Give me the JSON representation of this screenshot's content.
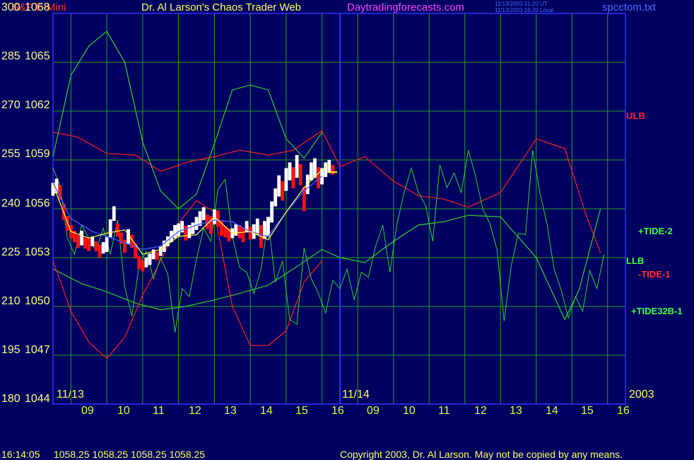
{
  "header": {
    "instrument": "S&P E-Mini",
    "site_title": "Dr. Al Larson's Chaos Trader Web",
    "website": "Daytradingforecasts.com",
    "timestamp_ut": "11/13/2003 21:20 UT",
    "timestamp_local": "11/13/2003 16:20 Local",
    "filename": "spcctom.txt"
  },
  "footer": {
    "time": "16:14:05",
    "quotes": "1058.25 1058.25 1058.25 1058.25",
    "copyright": "Copyright 2003, Dr. Al Larson. May not be copied by any means."
  },
  "colors": {
    "background": "#000060",
    "grid": "#1fa01f",
    "price_up": "#ffffff",
    "price_down": "#ff1010",
    "tide": "#2fd02f",
    "band": "#ff2020",
    "divider": "#3030ff"
  },
  "chart_data": {
    "type": "line",
    "y_left_ticks": [
      "300",
      "285",
      "270",
      "255",
      "240",
      "225",
      "210",
      "195",
      "180"
    ],
    "y_right_ticks": [
      "1068",
      "1065",
      "1062",
      "1059",
      "1056",
      "1053",
      "1050",
      "1047",
      "1044"
    ],
    "ylim_price": [
      1044,
      1068
    ],
    "ylim_index": [
      180,
      300
    ],
    "day_labels": [
      "11/13",
      "11/14"
    ],
    "year_label": "2003",
    "x_hours_day1": [
      "09",
      "10",
      "11",
      "12",
      "13",
      "14",
      "15",
      "16"
    ],
    "x_hours_day2": [
      "09",
      "10",
      "11",
      "12",
      "13",
      "14",
      "15",
      "16"
    ],
    "grid": true,
    "annotations": [
      {
        "text": "ULB",
        "color": "#ff2020"
      },
      {
        "text": "+TIDE-2",
        "color": "#40ff40"
      },
      {
        "text": "LLB",
        "color": "#40ff40"
      },
      {
        "text": "-TIDE-1",
        "color": "#ff3030"
      },
      {
        "text": "+TIDE32B-1",
        "color": "#40ff40"
      }
    ],
    "series": [
      {
        "name": "ULB",
        "color": "#ff2020",
        "x": [
          8.5,
          9.2,
          10,
          10.8,
          11.5,
          12.3,
          13,
          13.7,
          14.5,
          15.2,
          16,
          16.5,
          17.2,
          18,
          18.7,
          19.4,
          20.1,
          21,
          22,
          22.8,
          23.4,
          23.8
        ],
        "y": [
          1060.7,
          1060.4,
          1059.4,
          1059.3,
          1058.3,
          1058.9,
          1059.2,
          1059.6,
          1059.3,
          1059.6,
          1060.8,
          1058.6,
          1059.2,
          1057.7,
          1056.8,
          1056.6,
          1056.1,
          1057.0,
          1060.3,
          1059.7,
          1055.6,
          1053.3
        ]
      },
      {
        "name": "LLB",
        "color": "#2fd02f",
        "x": [
          8.5,
          9.3,
          10,
          10.8,
          11.5,
          12.2,
          13,
          13.7,
          14.5,
          15.2,
          16,
          16.5,
          17.2,
          18,
          18.7,
          19.4,
          20.1,
          21,
          22,
          22.8,
          23.2,
          23.8
        ],
        "y": [
          1052.3,
          1051.4,
          1050.9,
          1050.2,
          1049.8,
          1050.0,
          1050.4,
          1050.8,
          1051.3,
          1052.3,
          1053.5,
          1053.0,
          1052.7,
          1054.0,
          1055.0,
          1055.2,
          1055.6,
          1055.5,
          1053.0,
          1049.2,
          1051.0,
          1056.0
        ]
      },
      {
        "name": "-TIDE-1",
        "color": "#ff2020",
        "x": [
          8.5,
          9,
          9.5,
          10,
          10.5,
          11,
          11.5,
          12,
          12.5,
          13,
          13.5,
          14,
          14.5,
          15,
          15.5,
          16
        ],
        "y": [
          1052.8,
          1049.7,
          1047.8,
          1046.8,
          1048.1,
          1050.7,
          1052.8,
          1055.1,
          1056.5,
          1055.8,
          1050.0,
          1047.6,
          1047.6,
          1048.5,
          1051.5,
          1052.8
        ]
      },
      {
        "name": "+TIDE-2",
        "color": "#2fd02f",
        "x": [
          8.5,
          9,
          9.5,
          10,
          10.5,
          11,
          11.5,
          12,
          12.5,
          13,
          13.5,
          14,
          14.5,
          15,
          15.5,
          16
        ],
        "y": [
          1059.2,
          1064.2,
          1066.0,
          1066.9,
          1065.0,
          1060.1,
          1057.1,
          1056.0,
          1056.9,
          1060.0,
          1063.3,
          1063.6,
          1063.3,
          1060.3,
          1059.1,
          1060.7
        ]
      }
    ],
    "tide32": {
      "name": "+TIDE32B-1",
      "color": "#2fd02f",
      "x": [
        8.5,
        8.7,
        8.9,
        9.1,
        9.3,
        9.5,
        9.7,
        9.9,
        10.1,
        10.3,
        10.5,
        10.7,
        10.9,
        11.1,
        11.3,
        11.5,
        11.7,
        11.9,
        12.1,
        12.3,
        12.5,
        12.7,
        12.9,
        13.1,
        13.3,
        13.5,
        13.7,
        13.9,
        14.1,
        14.3,
        14.5,
        14.7,
        14.9,
        15.1,
        15.3,
        15.5,
        15.7,
        15.9,
        16.1,
        16.3,
        16.5,
        16.7,
        16.9,
        17.1,
        17.3,
        17.5,
        17.7,
        17.9,
        18.1,
        18.3,
        18.5,
        18.7,
        18.9,
        19.1,
        19.3,
        19.5,
        19.7,
        19.9,
        20.1,
        20.3,
        20.5,
        20.7,
        20.9,
        21.1,
        21.3,
        21.5,
        21.7,
        21.9,
        22.1,
        22.3,
        22.5,
        22.7,
        22.9,
        23.1,
        23.3,
        23.5,
        23.7,
        23.9
      ],
      "y": [
        1058.5,
        1057.4,
        1054.2,
        1053.2,
        1055.0,
        1054.2,
        1053.4,
        1054.8,
        1053.2,
        1055.3,
        1051.2,
        1049.4,
        1052.5,
        1053.4,
        1051.7,
        1053.0,
        1052.0,
        1048.4,
        1051.1,
        1050.6,
        1052.9,
        1054.8,
        1054.0,
        1057.2,
        1057.8,
        1054.3,
        1052.4,
        1052.1,
        1050.8,
        1052.3,
        1055.3,
        1051.5,
        1052.8,
        1049.2,
        1048.9,
        1053.6,
        1051.7,
        1050.8,
        1049.6,
        1051.6,
        1051.1,
        1052.3,
        1050.4,
        1052.1,
        1051.8,
        1053.7,
        1055.0,
        1052.1,
        1055.1,
        1057.0,
        1058.5,
        1057.0,
        1056.2,
        1054.0,
        1058.7,
        1057.3,
        1058.2,
        1057.0,
        1059.6,
        1058.0,
        1056.0,
        1055.1,
        1053.5,
        1049.1,
        1052.5,
        1054.5,
        1054.4,
        1059.6,
        1057.0,
        1055.1,
        1052.3,
        1051.0,
        1049.3,
        1050.6,
        1049.7,
        1052.2,
        1051.1,
        1053.2
      ]
    },
    "avg_line": {
      "name": "blue moving average",
      "color": "#4060ff",
      "x": [
        8.5,
        9,
        9.6,
        10,
        10.5,
        11,
        11.5,
        12,
        12.5,
        13,
        13.5,
        14,
        14.5,
        15,
        15.5,
        16
      ],
      "y": [
        1057.6,
        1055.4,
        1054.6,
        1054.3,
        1053.9,
        1053.5,
        1053.7,
        1054.6,
        1055.0,
        1055.3,
        1055.2,
        1054.6,
        1054.3,
        1055.8,
        1057.1,
        1058.0
      ]
    },
    "yellow_line": {
      "name": "yellow average",
      "color": "#ffff40",
      "x": [
        8.5,
        9,
        9.5,
        10,
        10.5,
        11,
        11.5,
        12,
        12.5,
        13,
        13.5,
        14,
        14.5,
        15,
        15.5,
        16,
        16.2
      ],
      "y": [
        1057.5,
        1054.6,
        1054.2,
        1054.5,
        1054.7,
        1053.2,
        1053.5,
        1054.3,
        1054.4,
        1055.5,
        1054.5,
        1054.6,
        1054.1,
        1055.8,
        1057.3,
        1058.4,
        1058.7
      ]
    },
    "price": {
      "name": "S&P E-Mini 15 min",
      "x_start": 8.5,
      "x_step": 0.1,
      "close": [
        1057.2,
        1057.4,
        1057.0,
        1055.8,
        1055.1,
        1054.6,
        1054.3,
        1054.0,
        1054.2,
        1053.9,
        1053.8,
        1054.0,
        1053.7,
        1053.4,
        1053.6,
        1053.8,
        1054.8,
        1055.7,
        1054.7,
        1054.2,
        1053.7,
        1054.3,
        1054.0,
        1053.4,
        1052.7,
        1052.5,
        1052.7,
        1052.9,
        1053.2,
        1053.1,
        1053.4,
        1053.7,
        1054.0,
        1054.3,
        1054.6,
        1054.7,
        1054.9,
        1054.5,
        1054.6,
        1054.8,
        1055.1,
        1055.4,
        1055.7,
        1055.2,
        1055.0,
        1055.5,
        1055.4,
        1054.8,
        1054.6,
        1054.4,
        1054.5,
        1054.7,
        1054.6,
        1054.4,
        1054.9,
        1054.5,
        1054.6,
        1054.9,
        1054.3,
        1054.7,
        1054.9,
        1055.8,
        1056.7,
        1057.4,
        1057.1,
        1057.8,
        1058.3,
        1057.9,
        1058.6,
        1058.1,
        1056.6,
        1057.5,
        1058.3,
        1058.5,
        1057.9,
        1058.0,
        1058.4,
        1058.6,
        1058.4
      ],
      "range": [
        0.8,
        0.9,
        0.9,
        1.0,
        0.9,
        0.8,
        0.7,
        0.8,
        0.9,
        0.7,
        0.8,
        0.6,
        0.6,
        0.8,
        0.7,
        0.9,
        1.1,
        0.9,
        0.8,
        0.7,
        0.8,
        0.9,
        0.8,
        0.9,
        0.8,
        0.7,
        0.6,
        0.7,
        0.6,
        0.5,
        0.6,
        0.7,
        0.6,
        0.7,
        0.8,
        0.8,
        0.7,
        0.9,
        0.8,
        0.7,
        0.8,
        0.9,
        0.8,
        0.9,
        1.1,
        0.9,
        1.0,
        0.9,
        0.7,
        0.8,
        0.6,
        0.7,
        0.8,
        0.9,
        0.7,
        0.8,
        0.9,
        1.0,
        1.4,
        1.1,
        1.2,
        1.3,
        1.1,
        1.3,
        1.2,
        1.4,
        1.1,
        1.3,
        1.4,
        1.3,
        1.5,
        1.2,
        1.1,
        1.2,
        1.3,
        1.0,
        0.9,
        0.8,
        0.6
      ],
      "last_close": 1058.25
    }
  }
}
